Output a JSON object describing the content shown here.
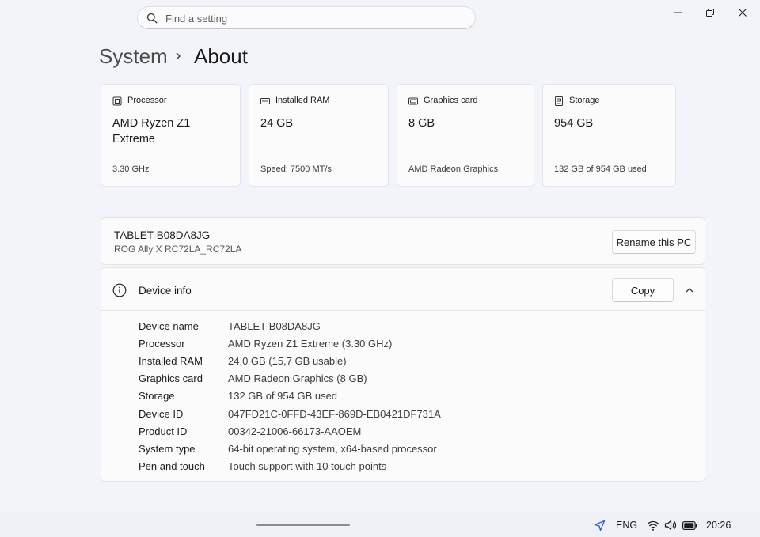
{
  "search": {
    "placeholder": "Find a setting"
  },
  "breadcrumb": {
    "parent": "System",
    "current": "About"
  },
  "specs": [
    {
      "icon": "processor-icon",
      "label": "Processor",
      "value": "AMD Ryzen Z1 Extreme",
      "sub": "3.30 GHz"
    },
    {
      "icon": "ram-icon",
      "label": "Installed RAM",
      "value": "24 GB",
      "sub": "Speed: 7500 MT/s"
    },
    {
      "icon": "graphics-card-icon",
      "label": "Graphics card",
      "value": "8 GB",
      "sub": "AMD Radeon Graphics"
    },
    {
      "icon": "storage-icon",
      "label": "Storage",
      "value": "954 GB",
      "sub": "132 GB of 954 GB used"
    }
  ],
  "pc": {
    "name": "TABLET-B08DA8JG",
    "model": "ROG Ally X RC72LA_RC72LA",
    "rename_label": "Rename this PC"
  },
  "device_info": {
    "title": "Device info",
    "copy_label": "Copy",
    "rows": [
      {
        "key": "Device name",
        "value": "TABLET-B08DA8JG"
      },
      {
        "key": "Processor",
        "value": "AMD Ryzen Z1 Extreme (3.30 GHz)"
      },
      {
        "key": "Installed RAM",
        "value": "24,0 GB (15,7 GB usable)"
      },
      {
        "key": "Graphics card",
        "value": "AMD Radeon Graphics (8 GB)"
      },
      {
        "key": "Storage",
        "value": "132 GB of 954 GB used"
      },
      {
        "key": "Device ID",
        "value": "047FD21C-0FFD-43EF-869D-EB0421DF731A"
      },
      {
        "key": "Product ID",
        "value": "00342-21006-66173-AAOEM"
      },
      {
        "key": "System type",
        "value": "64-bit operating system, x64-based processor"
      },
      {
        "key": "Pen and touch",
        "value": "Touch support with 10 touch points"
      }
    ]
  },
  "taskbar": {
    "language": "ENG",
    "time": "20:26"
  }
}
